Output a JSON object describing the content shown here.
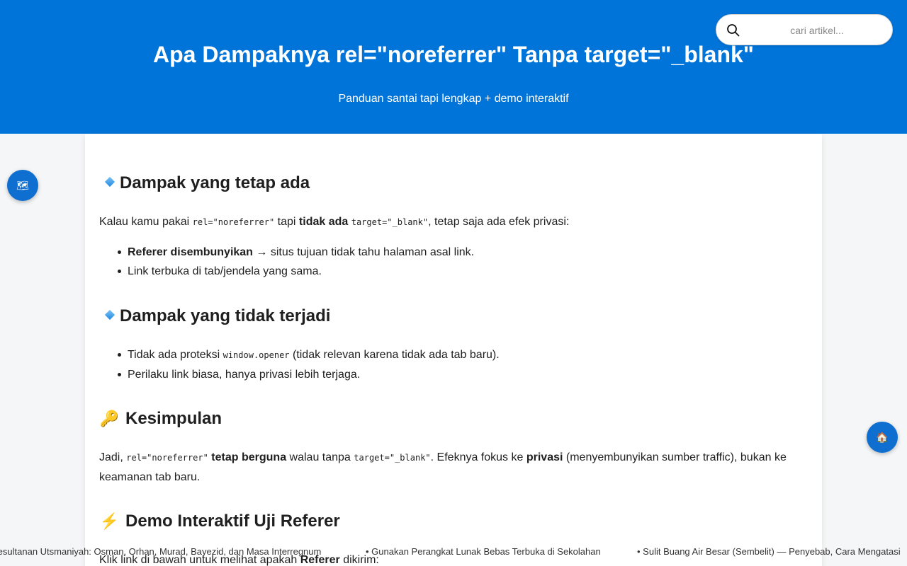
{
  "header": {
    "title": "Apa Dampaknya rel=\"noreferrer\" Tanpa target=\"_blank\"",
    "subtitle": "Panduan santai tapi lengkap + demo interaktif",
    "background_color": "#0074d9"
  },
  "search": {
    "placeholder": "cari artikel...",
    "icon": "search-icon"
  },
  "sections": {
    "s1": {
      "icon": "blue-diamond-icon",
      "heading": "Dampak yang tetap ada",
      "para": {
        "t1": "Kalau kamu pakai ",
        "c1": "rel=\"noreferrer\"",
        "t2": " tapi ",
        "b1": "tidak ada",
        "t3": " ",
        "c2": "target=\"_blank\"",
        "t4": ", tetap saja ada efek privasi:"
      },
      "li1": {
        "b": "Referer disembunyikan",
        "t": " → situs tujuan tidak tahu halaman asal link."
      },
      "li2": {
        "t": "Link terbuka di tab/jendela yang sama."
      }
    },
    "s2": {
      "icon": "blue-diamond-icon",
      "heading": "Dampak yang tidak terjadi",
      "li1": {
        "t1": "Tidak ada proteksi ",
        "c": "window.opener",
        "t2": " (tidak relevan karena tidak ada tab baru)."
      },
      "li2": {
        "t": "Perilaku link biasa, hanya privasi lebih terjaga."
      }
    },
    "s3": {
      "icon": "🔑",
      "heading": "Kesimpulan",
      "para": {
        "t1": "Jadi, ",
        "c1": "rel=\"noreferrer\"",
        "t2": " ",
        "b1": "tetap berguna",
        "t3": " walau tanpa ",
        "c2": "target=\"_blank\"",
        "t4": ". Efeknya fokus ke ",
        "b2": "privasi",
        "t5": " (menyembunyikan sumber traffic), bukan ke keamanan tab baru."
      }
    },
    "s4": {
      "icon": "⚡",
      "heading": "Demo Interaktif Uji Referer",
      "para": {
        "t1": "Klik link di bawah untuk melihat apakah ",
        "b1": "Referer",
        "t2": " dikirim:"
      }
    }
  },
  "fabs": {
    "map": {
      "glyph": "🗺",
      "icon": "map-icon"
    },
    "home": {
      "glyph": "🏠",
      "icon": "home-icon"
    }
  },
  "ticker": [
    "Kesultanan Utsmaniyah: Osman, Orhan, Murad, Bayezid, dan Masa Interregnum",
    "• Gunakan Perangkat Lunak Bebas Terbuka di Sekolahan",
    "• Sulit Buang Air Besar (Sembelit) — Penyebab, Cara Mengatasi"
  ]
}
